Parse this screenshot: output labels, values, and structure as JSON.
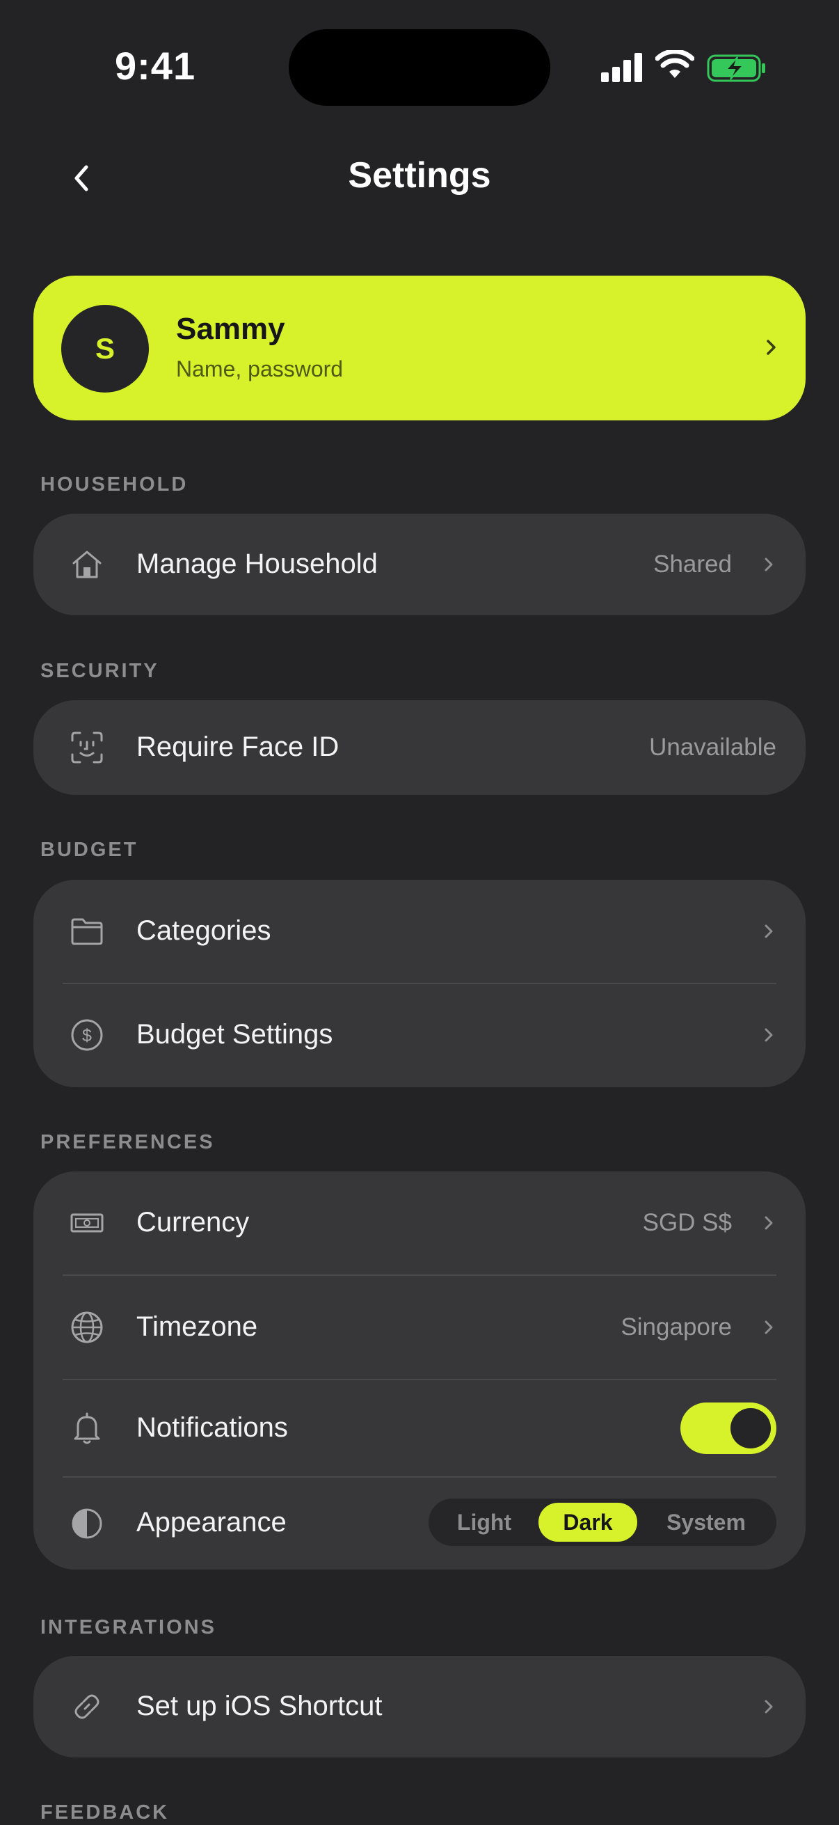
{
  "status_bar": {
    "time": "9:41"
  },
  "nav": {
    "title": "Settings"
  },
  "profile": {
    "initial": "S",
    "name": "Sammy",
    "subtitle": "Name, password"
  },
  "sections": {
    "household": {
      "label": "HOUSEHOLD",
      "items": [
        {
          "icon": "house-icon",
          "label": "Manage Household",
          "value": "Shared"
        }
      ]
    },
    "security": {
      "label": "SECURITY",
      "items": [
        {
          "icon": "face-id-icon",
          "label": "Require Face ID",
          "value": "Unavailable"
        }
      ]
    },
    "budget": {
      "label": "BUDGET",
      "items": [
        {
          "icon": "folder-icon",
          "label": "Categories"
        },
        {
          "icon": "dollar-circle-icon",
          "label": "Budget Settings"
        }
      ]
    },
    "preferences": {
      "label": "PREFERENCES",
      "items": [
        {
          "icon": "banknote-icon",
          "label": "Currency",
          "value": "SGD S$"
        },
        {
          "icon": "globe-icon",
          "label": "Timezone",
          "value": "Singapore"
        },
        {
          "icon": "bell-icon",
          "label": "Notifications",
          "toggle_on": true
        },
        {
          "icon": "half-circle-icon",
          "label": "Appearance",
          "options": [
            "Light",
            "Dark",
            "System"
          ],
          "selected": "Dark"
        }
      ]
    },
    "integrations": {
      "label": "INTEGRATIONS",
      "items": [
        {
          "icon": "link-icon",
          "label": "Set up iOS Shortcut"
        }
      ]
    },
    "feedback": {
      "label": "FEEDBACK"
    }
  },
  "colors": {
    "accent": "#d7f22b",
    "background": "#232325",
    "card": "#373739"
  }
}
